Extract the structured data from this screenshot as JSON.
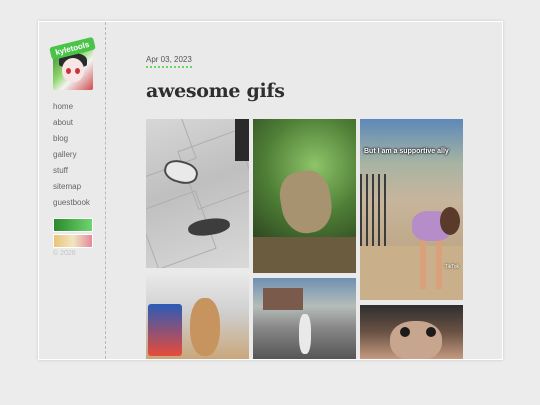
{
  "site": {
    "badge": "kyletools",
    "nav": [
      "home",
      "about",
      "blog",
      "gallery",
      "stuff",
      "sitemap",
      "guestbook"
    ],
    "copyright": "© 2026"
  },
  "post": {
    "date": "Apr 03, 2023",
    "title": "awesome gifs",
    "gifs": [
      {
        "name": "cats-on-tile"
      },
      {
        "name": "forest-animal"
      },
      {
        "name": "yoga-balcony",
        "caption": "But I am a supportive ally",
        "watermark": "TikTok"
      },
      {
        "name": "dog-and-chips"
      },
      {
        "name": "skeleton-street"
      },
      {
        "name": "dog-face-closeup"
      }
    ]
  },
  "colors": {
    "accent": "#49c449",
    "text": "#2e2e2e",
    "muted": "#666666",
    "background": "#eaeaea"
  }
}
